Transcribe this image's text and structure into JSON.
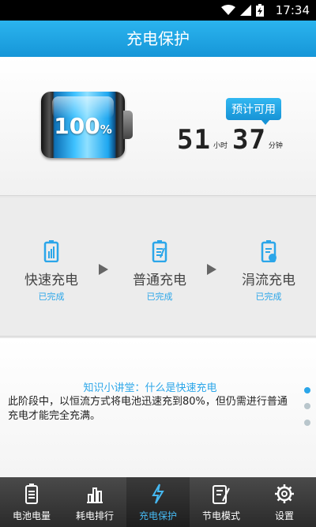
{
  "status_bar": {
    "time": "17:34",
    "icons": [
      "wifi-icon",
      "signal-icon",
      "battery-charging-icon"
    ]
  },
  "title": "充电保护",
  "battery": {
    "percent_number": "100",
    "percent_sign": "%"
  },
  "estimate": {
    "badge": "预计可用",
    "hours": "51",
    "hours_unit": "小时",
    "minutes": "37",
    "minutes_unit": "分钟"
  },
  "stages": [
    {
      "name": "快速充电",
      "status": "已完成",
      "icon": "fast-charge-icon"
    },
    {
      "name": "普通充电",
      "status": "已完成",
      "icon": "normal-charge-icon"
    },
    {
      "name": "涓流充电",
      "status": "已完成",
      "icon": "trickle-charge-icon"
    }
  ],
  "tips": {
    "title": "知识小讲堂：什么是快速充电",
    "body": "此阶段中，以恒流方式将电池迅速充到80%，但仍需进行普通充电才能完全充满。",
    "pages": 3,
    "active_page": 1
  },
  "nav": [
    {
      "label": "电池电量",
      "icon": "battery-level-icon"
    },
    {
      "label": "耗电排行",
      "icon": "bar-chart-icon"
    },
    {
      "label": "充电保护",
      "icon": "lightning-icon",
      "active": true
    },
    {
      "label": "节电模式",
      "icon": "power-save-icon"
    },
    {
      "label": "设置",
      "icon": "gear-icon"
    }
  ],
  "colors": {
    "accent": "#2ba6e9",
    "title_bar": "#1696d8",
    "nav_bg": "#2b2b2b"
  }
}
